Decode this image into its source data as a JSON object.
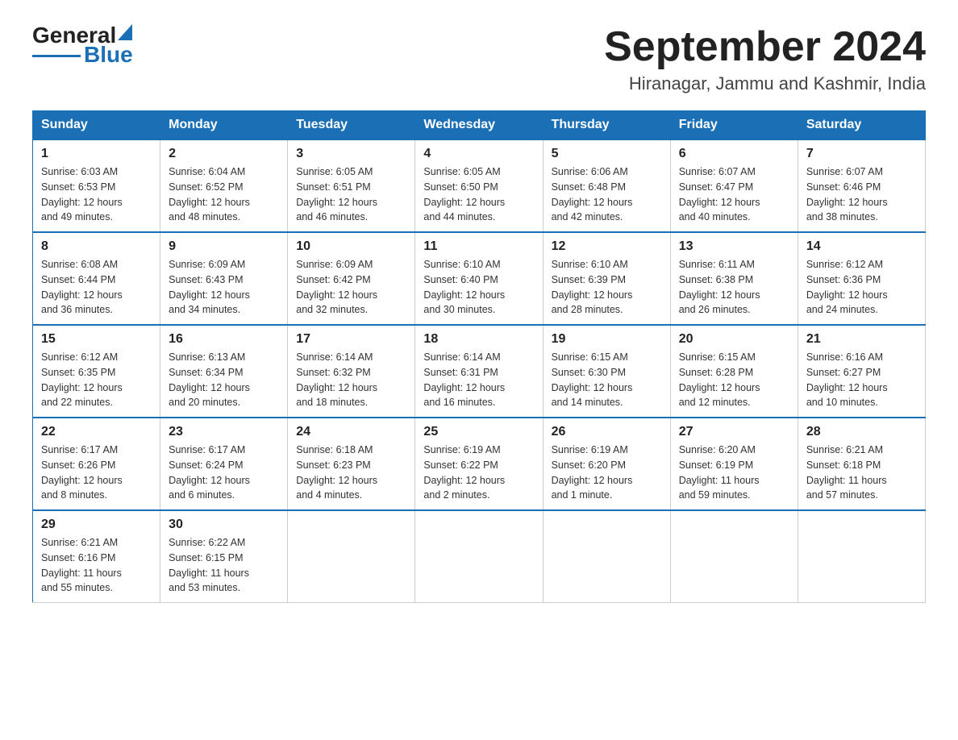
{
  "header": {
    "logo_general": "General",
    "logo_blue": "Blue",
    "title": "September 2024",
    "subtitle": "Hiranagar, Jammu and Kashmir, India"
  },
  "weekdays": [
    "Sunday",
    "Monday",
    "Tuesday",
    "Wednesday",
    "Thursday",
    "Friday",
    "Saturday"
  ],
  "weeks": [
    [
      {
        "day": "1",
        "info": "Sunrise: 6:03 AM\nSunset: 6:53 PM\nDaylight: 12 hours\nand 49 minutes."
      },
      {
        "day": "2",
        "info": "Sunrise: 6:04 AM\nSunset: 6:52 PM\nDaylight: 12 hours\nand 48 minutes."
      },
      {
        "day": "3",
        "info": "Sunrise: 6:05 AM\nSunset: 6:51 PM\nDaylight: 12 hours\nand 46 minutes."
      },
      {
        "day": "4",
        "info": "Sunrise: 6:05 AM\nSunset: 6:50 PM\nDaylight: 12 hours\nand 44 minutes."
      },
      {
        "day": "5",
        "info": "Sunrise: 6:06 AM\nSunset: 6:48 PM\nDaylight: 12 hours\nand 42 minutes."
      },
      {
        "day": "6",
        "info": "Sunrise: 6:07 AM\nSunset: 6:47 PM\nDaylight: 12 hours\nand 40 minutes."
      },
      {
        "day": "7",
        "info": "Sunrise: 6:07 AM\nSunset: 6:46 PM\nDaylight: 12 hours\nand 38 minutes."
      }
    ],
    [
      {
        "day": "8",
        "info": "Sunrise: 6:08 AM\nSunset: 6:44 PM\nDaylight: 12 hours\nand 36 minutes."
      },
      {
        "day": "9",
        "info": "Sunrise: 6:09 AM\nSunset: 6:43 PM\nDaylight: 12 hours\nand 34 minutes."
      },
      {
        "day": "10",
        "info": "Sunrise: 6:09 AM\nSunset: 6:42 PM\nDaylight: 12 hours\nand 32 minutes."
      },
      {
        "day": "11",
        "info": "Sunrise: 6:10 AM\nSunset: 6:40 PM\nDaylight: 12 hours\nand 30 minutes."
      },
      {
        "day": "12",
        "info": "Sunrise: 6:10 AM\nSunset: 6:39 PM\nDaylight: 12 hours\nand 28 minutes."
      },
      {
        "day": "13",
        "info": "Sunrise: 6:11 AM\nSunset: 6:38 PM\nDaylight: 12 hours\nand 26 minutes."
      },
      {
        "day": "14",
        "info": "Sunrise: 6:12 AM\nSunset: 6:36 PM\nDaylight: 12 hours\nand 24 minutes."
      }
    ],
    [
      {
        "day": "15",
        "info": "Sunrise: 6:12 AM\nSunset: 6:35 PM\nDaylight: 12 hours\nand 22 minutes."
      },
      {
        "day": "16",
        "info": "Sunrise: 6:13 AM\nSunset: 6:34 PM\nDaylight: 12 hours\nand 20 minutes."
      },
      {
        "day": "17",
        "info": "Sunrise: 6:14 AM\nSunset: 6:32 PM\nDaylight: 12 hours\nand 18 minutes."
      },
      {
        "day": "18",
        "info": "Sunrise: 6:14 AM\nSunset: 6:31 PM\nDaylight: 12 hours\nand 16 minutes."
      },
      {
        "day": "19",
        "info": "Sunrise: 6:15 AM\nSunset: 6:30 PM\nDaylight: 12 hours\nand 14 minutes."
      },
      {
        "day": "20",
        "info": "Sunrise: 6:15 AM\nSunset: 6:28 PM\nDaylight: 12 hours\nand 12 minutes."
      },
      {
        "day": "21",
        "info": "Sunrise: 6:16 AM\nSunset: 6:27 PM\nDaylight: 12 hours\nand 10 minutes."
      }
    ],
    [
      {
        "day": "22",
        "info": "Sunrise: 6:17 AM\nSunset: 6:26 PM\nDaylight: 12 hours\nand 8 minutes."
      },
      {
        "day": "23",
        "info": "Sunrise: 6:17 AM\nSunset: 6:24 PM\nDaylight: 12 hours\nand 6 minutes."
      },
      {
        "day": "24",
        "info": "Sunrise: 6:18 AM\nSunset: 6:23 PM\nDaylight: 12 hours\nand 4 minutes."
      },
      {
        "day": "25",
        "info": "Sunrise: 6:19 AM\nSunset: 6:22 PM\nDaylight: 12 hours\nand 2 minutes."
      },
      {
        "day": "26",
        "info": "Sunrise: 6:19 AM\nSunset: 6:20 PM\nDaylight: 12 hours\nand 1 minute."
      },
      {
        "day": "27",
        "info": "Sunrise: 6:20 AM\nSunset: 6:19 PM\nDaylight: 11 hours\nand 59 minutes."
      },
      {
        "day": "28",
        "info": "Sunrise: 6:21 AM\nSunset: 6:18 PM\nDaylight: 11 hours\nand 57 minutes."
      }
    ],
    [
      {
        "day": "29",
        "info": "Sunrise: 6:21 AM\nSunset: 6:16 PM\nDaylight: 11 hours\nand 55 minutes."
      },
      {
        "day": "30",
        "info": "Sunrise: 6:22 AM\nSunset: 6:15 PM\nDaylight: 11 hours\nand 53 minutes."
      },
      {
        "day": "",
        "info": ""
      },
      {
        "day": "",
        "info": ""
      },
      {
        "day": "",
        "info": ""
      },
      {
        "day": "",
        "info": ""
      },
      {
        "day": "",
        "info": ""
      }
    ]
  ]
}
